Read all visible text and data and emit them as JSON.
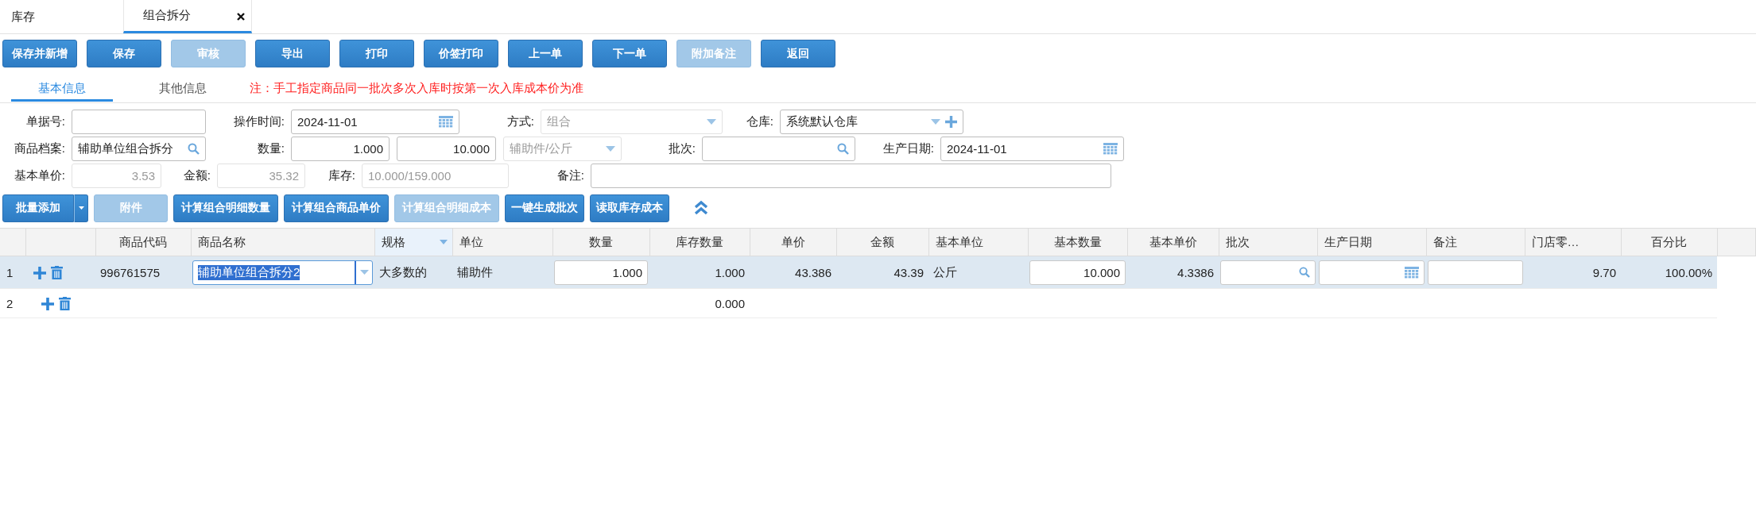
{
  "tabs": [
    {
      "label": "库存",
      "selected": false,
      "closable": false
    },
    {
      "label": "组合拆分",
      "selected": true,
      "closable": true
    }
  ],
  "toolbar": [
    {
      "label": "保存并新增",
      "disabled": false
    },
    {
      "label": "保存",
      "disabled": false
    },
    {
      "label": "审核",
      "disabled": true
    },
    {
      "label": "导出",
      "disabled": false
    },
    {
      "label": "打印",
      "disabled": false
    },
    {
      "label": "价签打印",
      "disabled": false
    },
    {
      "label": "上一单",
      "disabled": false
    },
    {
      "label": "下一单",
      "disabled": false
    },
    {
      "label": "附加备注",
      "disabled": true
    },
    {
      "label": "返回",
      "disabled": false
    }
  ],
  "subtabs": [
    {
      "label": "基本信息",
      "selected": true
    },
    {
      "label": "其他信息",
      "selected": false
    }
  ],
  "notice": "注：手工指定商品同一批次多次入库时按第一次入库成本价为准",
  "form": [
    [
      {
        "label": "单据号:",
        "kind": "text",
        "disabled": false
      },
      {
        "label": "操作时间:",
        "kind": "date",
        "value": "2024-11-01",
        "disabled": false
      },
      {
        "label": "方式:",
        "kind": "select",
        "value": "组合",
        "disabled": true
      },
      {
        "label": "仓库:",
        "kind": "select-add",
        "value": "系统默认仓库",
        "disabled": false
      }
    ],
    [
      {
        "label": "商品档案:",
        "kind": "search",
        "value": "辅助单位组合拆分",
        "disabled": false
      },
      {
        "label": "数量:",
        "kind": "number",
        "value": "1.000",
        "disabled": false
      },
      {
        "kind": "number",
        "value": "10.000",
        "disabled": false
      },
      {
        "kind": "select",
        "value": "辅助件/公斤",
        "disabled": true
      },
      {
        "label": "批次:",
        "kind": "search",
        "disabled": false
      },
      {
        "label": "生产日期:",
        "kind": "date",
        "value": "2024-11-01",
        "disabled": false
      }
    ],
    [
      {
        "label": "基本单价:",
        "kind": "number",
        "value": "3.53",
        "disabled": true
      },
      {
        "label": "金额:",
        "kind": "number",
        "value": "35.32",
        "disabled": true
      },
      {
        "label": "库存:",
        "kind": "text",
        "value": "10.000/159.000",
        "disabled": true
      },
      {
        "label": "备注:",
        "kind": "text",
        "disabled": false
      }
    ]
  ],
  "actions": [
    {
      "label": "批量添加",
      "disabled": false,
      "split": true
    },
    {
      "label": "附件",
      "disabled": true,
      "split": false
    },
    {
      "label": "计算组合明细数量",
      "disabled": false,
      "split": false
    },
    {
      "label": "计算组合商品单价",
      "disabled": false,
      "split": false
    },
    {
      "label": "计算组合明细成本",
      "disabled": true,
      "split": false
    },
    {
      "label": "一键生成批次",
      "disabled": false,
      "split": false
    },
    {
      "label": "读取库存成本",
      "disabled": false,
      "split": false
    }
  ],
  "table": {
    "columns": [
      {
        "label": "商品代码",
        "hovered": false
      },
      {
        "label": "商品名称",
        "hovered": false
      },
      {
        "label": "规格",
        "hovered": true
      },
      {
        "label": "单位",
        "hovered": false
      },
      {
        "label": "数量",
        "hovered": false
      },
      {
        "label": "库存数量",
        "hovered": false
      },
      {
        "label": "单价",
        "hovered": false
      },
      {
        "label": "金额",
        "hovered": false
      },
      {
        "label": "基本单位",
        "hovered": false
      },
      {
        "label": "基本数量",
        "hovered": false
      },
      {
        "label": "基本单价",
        "hovered": false
      },
      {
        "label": "批次",
        "hovered": false
      },
      {
        "label": "生产日期",
        "hovered": false
      },
      {
        "label": "备注",
        "hovered": false
      },
      {
        "label": "门店零…",
        "hovered": false
      },
      {
        "label": "百分比",
        "hovered": false
      }
    ],
    "rows": [
      {
        "number": "1",
        "selected": true,
        "cells": [
          {
            "kind": "text",
            "value": "996761575"
          },
          {
            "kind": "combo",
            "value": "辅助单位组合拆分2"
          },
          {
            "kind": "text",
            "value": "大多数的"
          },
          {
            "kind": "text",
            "value": "辅助件"
          },
          {
            "kind": "input",
            "value": "1.000"
          },
          {
            "kind": "text",
            "value": "1.000"
          },
          {
            "kind": "text",
            "value": "43.386"
          },
          {
            "kind": "text",
            "value": "43.39"
          },
          {
            "kind": "text",
            "value": "公斤"
          },
          {
            "kind": "input",
            "value": "10.000"
          },
          {
            "kind": "text",
            "value": "4.3386"
          },
          {
            "kind": "search"
          },
          {
            "kind": "date"
          },
          {
            "kind": "input"
          },
          {
            "kind": "text",
            "value": "9.70"
          },
          {
            "kind": "text",
            "value": "100.00%"
          }
        ]
      },
      {
        "number": "2",
        "selected": false,
        "cells": [
          null,
          null,
          null,
          null,
          null,
          {
            "kind": "text",
            "value": "0.000"
          },
          null,
          null,
          null,
          null,
          null,
          null,
          null,
          null,
          null,
          null
        ]
      }
    ]
  }
}
